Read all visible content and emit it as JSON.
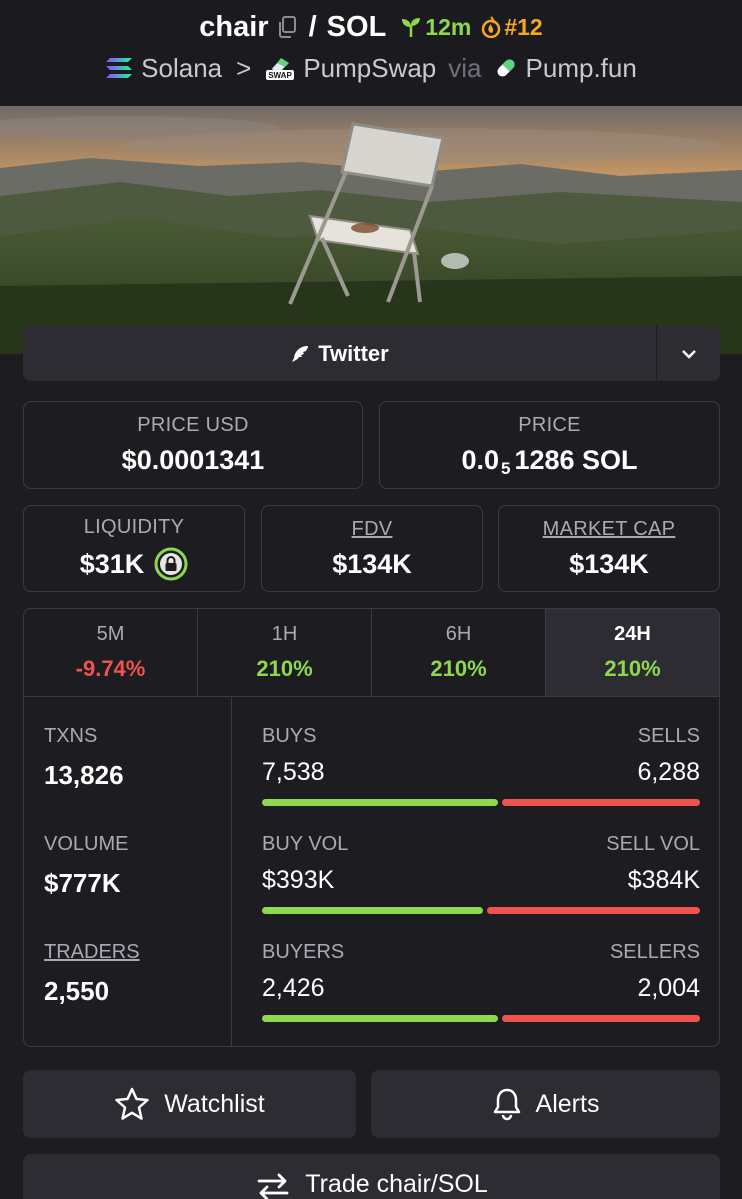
{
  "header": {
    "token_symbol": "chair",
    "quote_symbol": "SOL",
    "age": "12m",
    "rank": "#12",
    "chain": "Solana",
    "dex": "PumpSwap",
    "via_label": "via",
    "launchpad": "Pump.fun",
    "dex_badge": "SWAP"
  },
  "social": {
    "twitter_label": "Twitter"
  },
  "prices": {
    "price_usd_label": "PRICE USD",
    "price_usd": "$0.0001341",
    "price_label": "PRICE",
    "price_sol_prefix": "0.0",
    "price_sol_zeros": "5",
    "price_sol_rest": "1286 SOL"
  },
  "metrics": {
    "liquidity_label": "LIQUIDITY",
    "liquidity": "$31K",
    "fdv_label": "FDV",
    "fdv": "$134K",
    "mcap_label": "MARKET CAP",
    "mcap": "$134K"
  },
  "timeframes": [
    {
      "label": "5M",
      "change": "-9.74%",
      "direction": "down"
    },
    {
      "label": "1H",
      "change": "210%",
      "direction": "up"
    },
    {
      "label": "6H",
      "change": "210%",
      "direction": "up"
    },
    {
      "label": "24H",
      "change": "210%",
      "direction": "up",
      "active": true
    }
  ],
  "stats": {
    "txns_label": "TXNS",
    "txns": "13,826",
    "volume_label": "VOLUME",
    "volume": "$777K",
    "traders_label": "TRADERS",
    "traders": "2,550",
    "buys_label": "BUYS",
    "buys": "7,538",
    "sells_label": "SELLS",
    "sells": "6,288",
    "buy_vol_label": "BUY VOL",
    "buy_vol": "$393K",
    "sell_vol_label": "SELL VOL",
    "sell_vol": "$384K",
    "buyers_label": "BUYERS",
    "buyers": "2,426",
    "sellers_label": "SELLERS",
    "sellers": "2,004"
  },
  "actions": {
    "watchlist_label": "Watchlist",
    "alerts_label": "Alerts",
    "trade_label": "Trade chair/SOL"
  },
  "colors": {
    "background": "#1d1d21",
    "surface": "#2c2c32",
    "positive": "#8ed84d",
    "negative": "#ef5350",
    "rank": "#f6a822"
  }
}
